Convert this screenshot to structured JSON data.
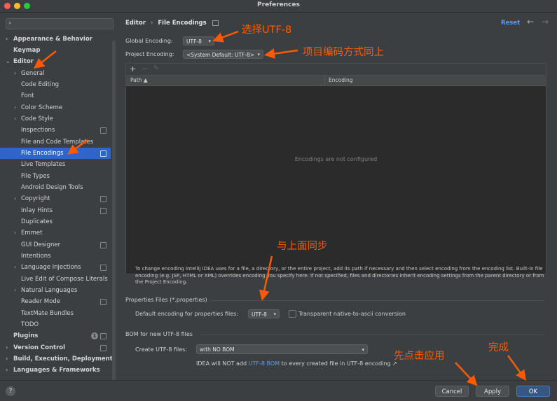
{
  "window": {
    "title": "Preferences"
  },
  "search": {
    "placeholder": ""
  },
  "sidebar": {
    "items": [
      {
        "label": "Appearance & Behavior"
      },
      {
        "label": "Keymap"
      },
      {
        "label": "Editor"
      },
      {
        "label": "General"
      },
      {
        "label": "Code Editing"
      },
      {
        "label": "Font"
      },
      {
        "label": "Color Scheme"
      },
      {
        "label": "Code Style"
      },
      {
        "label": "Inspections"
      },
      {
        "label": "File and Code Templates"
      },
      {
        "label": "File Encodings"
      },
      {
        "label": "Live Templates"
      },
      {
        "label": "File Types"
      },
      {
        "label": "Android Design Tools"
      },
      {
        "label": "Copyright"
      },
      {
        "label": "Inlay Hints"
      },
      {
        "label": "Duplicates"
      },
      {
        "label": "Emmet"
      },
      {
        "label": "GUI Designer"
      },
      {
        "label": "Intentions"
      },
      {
        "label": "Language Injections"
      },
      {
        "label": "Live Edit of Compose Literals"
      },
      {
        "label": "Natural Languages"
      },
      {
        "label": "Reader Mode"
      },
      {
        "label": "TextMate Bundles"
      },
      {
        "label": "TODO"
      },
      {
        "label": "Plugins",
        "badge": "1"
      },
      {
        "label": "Version Control"
      },
      {
        "label": "Build, Execution, Deployment"
      },
      {
        "label": "Languages & Frameworks"
      }
    ]
  },
  "header": {
    "crumb_parent": "Editor",
    "crumb_sep": "›",
    "crumb_current": "File Encodings",
    "reset": "Reset",
    "back": "←",
    "forward": "→"
  },
  "encoding": {
    "global_label": "Global Encoding:",
    "global_value": "UTF-8",
    "project_label": "Project Encoding:",
    "project_value": "<System Default: UTF-8>"
  },
  "table": {
    "add": "+",
    "remove": "−",
    "edit": "✎",
    "col_path": "Path ▲",
    "col_encoding": "Encoding",
    "empty": "Encodings are not configured"
  },
  "help": {
    "text": "To change encoding IntelliJ IDEA uses for a file, a directory, or the entire project, add its path if necessary and then select encoding from the encoding list. Built-in file encoding (e.g. JSP, HTML or XML) overrides encoding you specify here. If not specified, files and directories inherit encoding settings from the parent directory or from the Project Encoding."
  },
  "properties": {
    "section": "Properties Files (*.properties)",
    "default_label": "Default encoding for properties files:",
    "default_value": "UTF-8",
    "transparent_label": "Transparent native-to-ascii conversion"
  },
  "bom": {
    "section": "BOM for new UTF-8 files",
    "create_label": "Create UTF-8 files:",
    "create_value": "with NO BOM",
    "note_prefix": "IDEA will NOT add ",
    "note_link": "UTF-8 BOM",
    "note_suffix": " to every created file in UTF-8 encoding ↗"
  },
  "footer": {
    "help": "?",
    "cancel": "Cancel",
    "apply": "Apply",
    "ok": "OK"
  },
  "annotations": {
    "a1": "选择UTF-8",
    "a2": "项目编码方式同上",
    "a3": "与上面同步",
    "a4": "先点击应用",
    "a5": "完成"
  },
  "colors": {
    "accent": "#2f65ca",
    "annotation": "#ff5a00",
    "link": "#589df6"
  }
}
